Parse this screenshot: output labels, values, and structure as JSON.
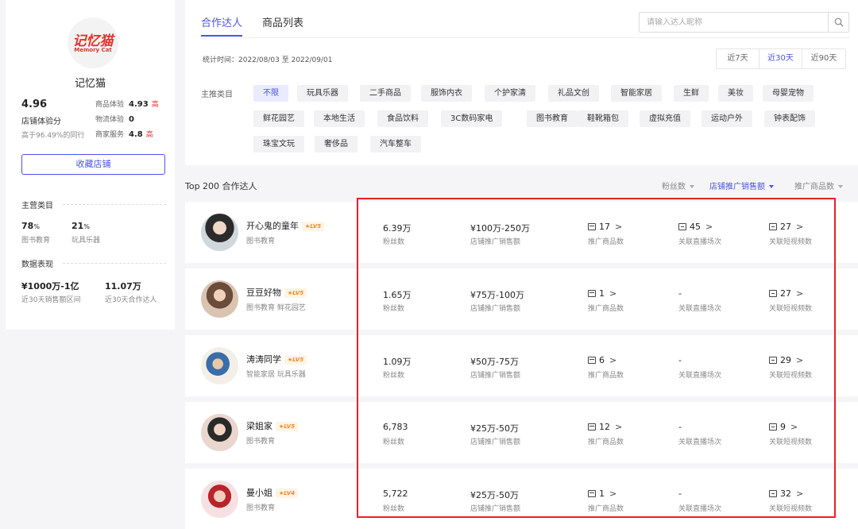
{
  "store": {
    "logo_cn": "记忆猫",
    "logo_en": "Memory Cat",
    "name": "记忆猫",
    "score": "4.96",
    "score_label": "店铺体验分",
    "score_rank": "高于96.49%的同行",
    "metrics": [
      {
        "label": "商品体验",
        "value": "4.93",
        "tag": "高"
      },
      {
        "label": "物流体验",
        "value": "0",
        "tag": ""
      },
      {
        "label": "商家服务",
        "value": "4.8",
        "tag": "高"
      }
    ],
    "collect_button": "收藏店铺",
    "main_category_title": "主营类目",
    "main_categories": [
      {
        "pct": "78",
        "unit": "%",
        "label": "图书教育"
      },
      {
        "pct": "21",
        "unit": "%",
        "label": "玩具乐器"
      }
    ],
    "data_title": "数据表现",
    "data": [
      {
        "value": "¥1000万-1亿",
        "label": "近30天销售额区间"
      },
      {
        "value": "11.07万",
        "label": "近30天合作达人"
      }
    ]
  },
  "tabs": [
    {
      "label": "合作达人"
    },
    {
      "label": "商品列表"
    }
  ],
  "search": {
    "placeholder": "请输入达人昵称"
  },
  "stat_time": "统计时间：2022/08/03 至 2022/09/01",
  "ranges": [
    {
      "label": "近7天"
    },
    {
      "label": "近30天"
    },
    {
      "label": "近90天"
    }
  ],
  "category_label": "主推类目",
  "categories": [
    "不限",
    "玩具乐器",
    "二手商品",
    "服饰内衣",
    "个护家清",
    "礼品文创",
    "智能家居",
    "生鲜",
    "美妆",
    "母婴宠物",
    "鲜花园艺",
    "本地生活",
    "食品饮料",
    "3C数码家电",
    "图书教育",
    "鞋靴箱包",
    "虚拟充值",
    "运动户外",
    "钟表配饰",
    "珠宝文玩",
    "奢侈品",
    "汽车整车"
  ],
  "list_title": "Top 200 合作达人",
  "sorts": [
    {
      "label": "粉丝数"
    },
    {
      "label": "店铺推广销售额"
    },
    {
      "label": "推广商品数"
    }
  ],
  "column_labels": {
    "fans": "粉丝数",
    "sales": "店铺推广销售额",
    "products": "推广商品数",
    "live": "关联直播场次",
    "videos": "关联短视频数"
  },
  "influencers": [
    {
      "name": "开心鬼的童年",
      "level": "LV5",
      "cats": "图书教育",
      "fans": "6.39万",
      "sales": "¥100万-250万",
      "products": "17",
      "live": "45",
      "videos": "27"
    },
    {
      "name": "豆豆好物",
      "level": "LV5",
      "cats": "图书教育 鲜花园艺",
      "fans": "1.65万",
      "sales": "¥75万-100万",
      "products": "1",
      "live": "-",
      "videos": "27"
    },
    {
      "name": "涛涛同学",
      "level": "LV5",
      "cats": "智能家居 玩具乐器",
      "fans": "1.09万",
      "sales": "¥50万-75万",
      "products": "6",
      "live": "-",
      "videos": "29"
    },
    {
      "name": "梁姐家",
      "level": "LV5",
      "cats": "图书教育",
      "fans": "6,783",
      "sales": "¥25万-50万",
      "products": "12",
      "live": "-",
      "videos": "9"
    },
    {
      "name": "曼小姐",
      "level": "LV4",
      "cats": "图书教育",
      "fans": "5,722",
      "sales": "¥25万-50万",
      "products": "1",
      "live": "-",
      "videos": "32"
    }
  ],
  "colors": {
    "accent": "#4b53e8",
    "highlight_box": "#e8202a",
    "brand": "#e5322d"
  }
}
